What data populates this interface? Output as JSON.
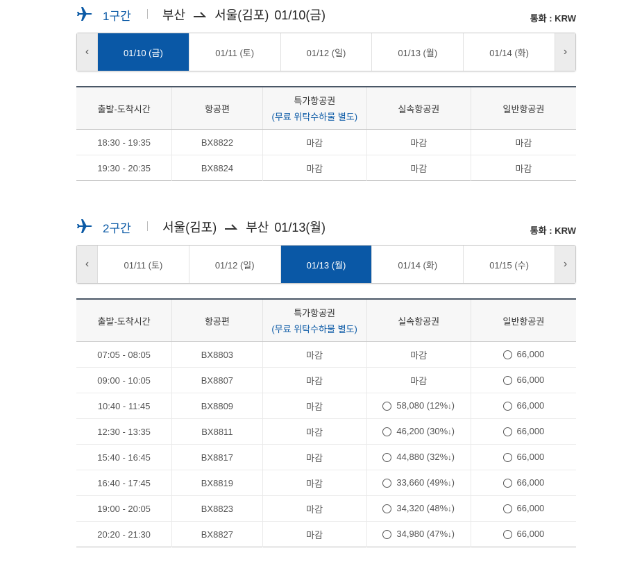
{
  "segments": [
    {
      "label": "1구간",
      "from": "부산",
      "to": "서울(김포)",
      "date": "01/10(금)",
      "currency": "통화 : KRW",
      "dates": [
        {
          "label": "01/10 (금)",
          "active": true
        },
        {
          "label": "01/11 (토)",
          "active": false
        },
        {
          "label": "01/12 (일)",
          "active": false
        },
        {
          "label": "01/13 (월)",
          "active": false
        },
        {
          "label": "01/14 (화)",
          "active": false
        }
      ],
      "headers": {
        "time": "출발-도착시간",
        "flight": "항공편",
        "special": "특가항공권",
        "special_note": "(무료 위탁수하물 별도)",
        "discount": "실속항공권",
        "normal": "일반항공권"
      },
      "rows": [
        {
          "time": "18:30 - 19:35",
          "flight": "BX8822",
          "special": {
            "text": "마감",
            "selectable": false
          },
          "discount": {
            "text": "마감",
            "selectable": false
          },
          "normal": {
            "text": "마감",
            "selectable": false
          }
        },
        {
          "time": "19:30 - 20:35",
          "flight": "BX8824",
          "special": {
            "text": "마감",
            "selectable": false
          },
          "discount": {
            "text": "마감",
            "selectable": false
          },
          "normal": {
            "text": "마감",
            "selectable": false
          }
        }
      ]
    },
    {
      "label": "2구간",
      "from": "서울(김포)",
      "to": "부산",
      "date": "01/13(월)",
      "currency": "통화 : KRW",
      "dates": [
        {
          "label": "01/11 (토)",
          "active": false
        },
        {
          "label": "01/12 (일)",
          "active": false
        },
        {
          "label": "01/13 (월)",
          "active": true
        },
        {
          "label": "01/14 (화)",
          "active": false
        },
        {
          "label": "01/15 (수)",
          "active": false
        }
      ],
      "headers": {
        "time": "출발-도착시간",
        "flight": "항공편",
        "special": "특가항공권",
        "special_note": "(무료 위탁수하물 별도)",
        "discount": "실속항공권",
        "normal": "일반항공권"
      },
      "rows": [
        {
          "time": "07:05 - 08:05",
          "flight": "BX8803",
          "special": {
            "text": "마감",
            "selectable": false
          },
          "discount": {
            "text": "마감",
            "selectable": false
          },
          "normal": {
            "text": "66,000",
            "selectable": true
          }
        },
        {
          "time": "09:00 - 10:05",
          "flight": "BX8807",
          "special": {
            "text": "마감",
            "selectable": false
          },
          "discount": {
            "text": "마감",
            "selectable": false
          },
          "normal": {
            "text": "66,000",
            "selectable": true
          }
        },
        {
          "time": "10:40 - 11:45",
          "flight": "BX8809",
          "special": {
            "text": "마감",
            "selectable": false
          },
          "discount": {
            "text": "58,080 (12%",
            "selectable": true,
            "down": true
          },
          "normal": {
            "text": "66,000",
            "selectable": true
          }
        },
        {
          "time": "12:30 - 13:35",
          "flight": "BX8811",
          "special": {
            "text": "마감",
            "selectable": false
          },
          "discount": {
            "text": "46,200 (30%",
            "selectable": true,
            "down": true
          },
          "normal": {
            "text": "66,000",
            "selectable": true
          }
        },
        {
          "time": "15:40 - 16:45",
          "flight": "BX8817",
          "special": {
            "text": "마감",
            "selectable": false
          },
          "discount": {
            "text": "44,880 (32%",
            "selectable": true,
            "down": true
          },
          "normal": {
            "text": "66,000",
            "selectable": true
          }
        },
        {
          "time": "16:40 - 17:45",
          "flight": "BX8819",
          "special": {
            "text": "마감",
            "selectable": false
          },
          "discount": {
            "text": "33,660 (49%",
            "selectable": true,
            "down": true
          },
          "normal": {
            "text": "66,000",
            "selectable": true
          }
        },
        {
          "time": "19:00 - 20:05",
          "flight": "BX8823",
          "special": {
            "text": "마감",
            "selectable": false
          },
          "discount": {
            "text": "34,320 (48%",
            "selectable": true,
            "down": true
          },
          "normal": {
            "text": "66,000",
            "selectable": true
          }
        },
        {
          "time": "20:20 - 21:30",
          "flight": "BX8827",
          "special": {
            "text": "마감",
            "selectable": false
          },
          "discount": {
            "text": "34,980 (47%",
            "selectable": true,
            "down": true
          },
          "normal": {
            "text": "66,000",
            "selectable": true
          }
        }
      ]
    }
  ],
  "icons": {
    "plane": "airplane-icon",
    "route_arrow": "route-arrow-icon",
    "prev": "chevron-left-icon",
    "next": "chevron-right-icon",
    "down": "↓",
    "close_paren": ")"
  },
  "colors": {
    "accent": "#0a58a6",
    "text": "#333333"
  }
}
